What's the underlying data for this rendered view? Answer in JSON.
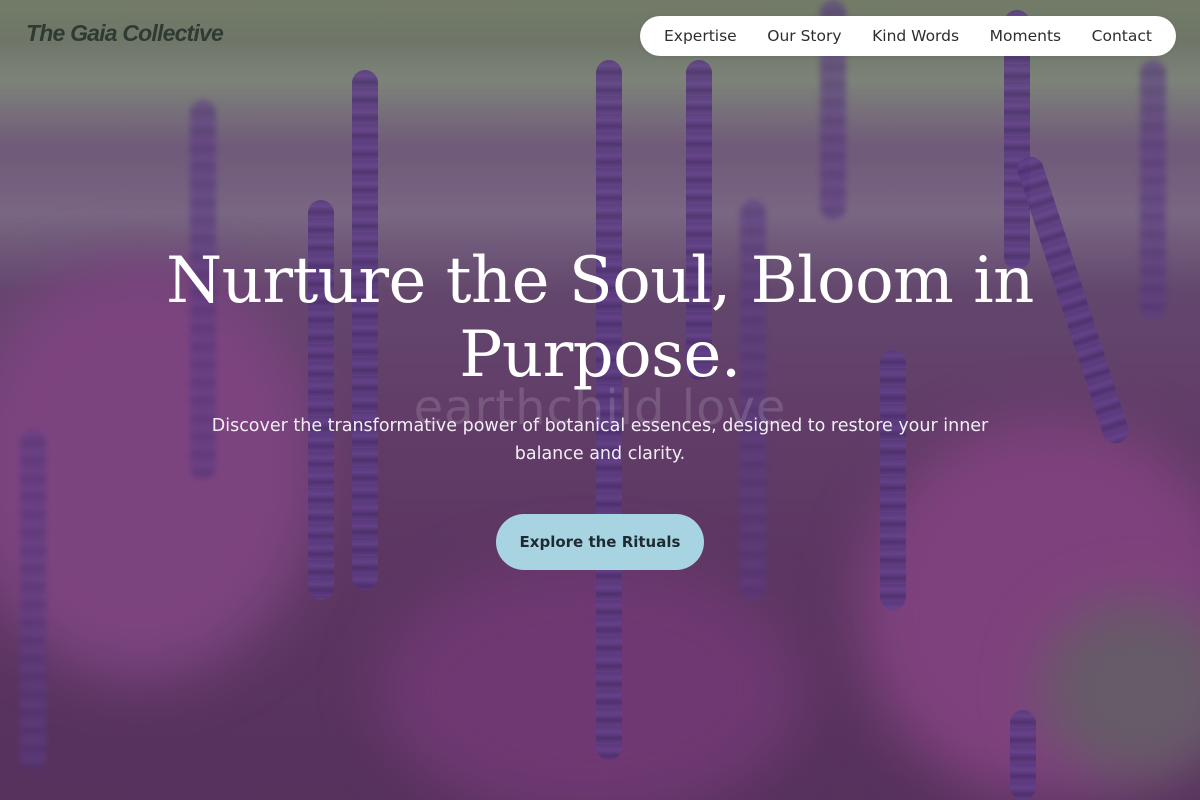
{
  "brand": {
    "name": "The Gaia Collective"
  },
  "nav": {
    "items": [
      {
        "label": "Expertise"
      },
      {
        "label": "Our Story"
      },
      {
        "label": "Kind Words"
      },
      {
        "label": "Moments"
      },
      {
        "label": "Contact"
      }
    ]
  },
  "hero": {
    "watermark": "earthchild love",
    "title": "Nurture the Soul, Bloom in Purpose.",
    "subtitle": "Discover the transformative power of botanical essences, designed to restore your inner balance and clarity.",
    "cta_label": "Explore the Rituals"
  },
  "colors": {
    "cta_background": "#a8d4e2",
    "nav_background": "#ffffff",
    "hero_tint": "#643d68",
    "brand_text": "#2f3a32"
  },
  "icons": {
    "hero_background": "lavender-field-photo"
  }
}
